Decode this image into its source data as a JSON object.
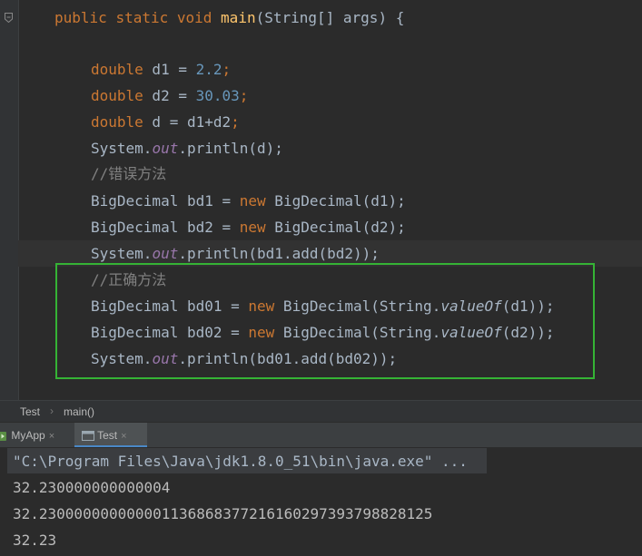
{
  "editor": {
    "method_signature": {
      "kw_public": "public",
      "kw_static": "static",
      "kw_void": "void",
      "method_name": "main",
      "params": "(String[] args) {"
    },
    "lines": [
      {
        "kw": "double",
        "rest": " d1 = ",
        "num": "2.2",
        "end": ";"
      },
      {
        "kw": "double",
        "rest": " d2 = ",
        "num": "30.03",
        "end": ";"
      },
      {
        "kw": "double",
        "rest": " d = d1+d2",
        "end": ";"
      },
      {
        "pre": "System.",
        "field": "out",
        "post": ".println(d);"
      },
      {
        "comment": "//错误方法"
      },
      {
        "pre": "BigDecimal bd1 = ",
        "kw": "new",
        "post": " BigDecimal(d1);"
      },
      {
        "pre": "BigDecimal bd2 = ",
        "kw": "new",
        "post": " BigDecimal(d2);"
      },
      {
        "pre": "System.",
        "field": "out",
        "post": ".println(bd1.add(bd2));"
      },
      {
        "comment": "//正确方法"
      },
      {
        "pre": "BigDecimal bd01 = ",
        "kw": "new",
        "mid": " BigDecimal(String.",
        "static": "valueOf",
        "post": "(d1));"
      },
      {
        "pre": "BigDecimal bd02 = ",
        "kw": "new",
        "mid": " BigDecimal(String.",
        "static": "valueOf",
        "post": "(d2));"
      },
      {
        "pre": "System.",
        "field": "out",
        "post": ".println(bd01.add(bd02));"
      }
    ]
  },
  "breadcrumb": {
    "class_name": "Test",
    "separator": "›",
    "method_name": "main()"
  },
  "run_tabs": [
    {
      "label": "MyApp",
      "close": "×"
    },
    {
      "label": "Test",
      "close": "×"
    }
  ],
  "console": {
    "command": "\"C:\\Program Files\\Java\\jdk1.8.0_51\\bin\\java.exe\" ...",
    "output": [
      "32.230000000000004",
      "32.230000000000001136868377216160297393798828125",
      "32.23"
    ]
  },
  "colors": {
    "editor_bg": "#2b2b2b",
    "keyword": "#cc7832",
    "number": "#6897bb",
    "function": "#ffc66d",
    "field": "#9876aa",
    "comment": "#808080",
    "highlight_box": "#35b335"
  }
}
